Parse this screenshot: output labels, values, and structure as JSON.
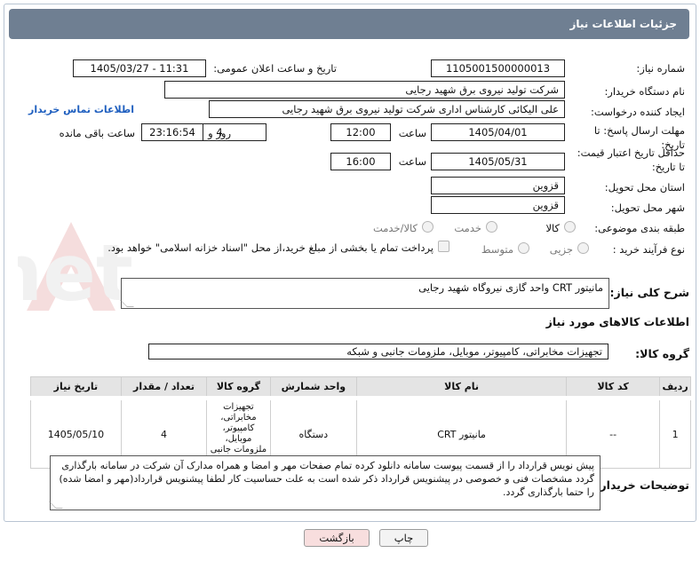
{
  "header": {
    "title": "جزئیات اطلاعات نیاز"
  },
  "fields": {
    "need_number_label": "شماره نیاز:",
    "need_number": "1105001500000013",
    "announce_label": "تاریخ و ساعت اعلان عمومی:",
    "announce_value": "1405/03/27 - 11:31",
    "buyer_org_label": "نام دستگاه خریدار:",
    "buyer_org": "شرکت تولید نیروی برق شهید رجایی",
    "creator_label": "ایجاد کننده درخواست:",
    "creator": "علی الیکائی کارشناس اداری شرکت تولید نیروی برق شهید رجایی",
    "contact_link": "اطلاعات تماس خریدار",
    "deadline_label_1": "مهلت ارسال پاسخ: تا",
    "deadline_label_2": "تاریخ:",
    "deadline_date": "1405/04/01",
    "time_label": "ساعت",
    "deadline_time": "12:00",
    "days_value": "4",
    "days_label": "روز و",
    "remaining_time": "23:16:54",
    "remaining_label": "ساعت باقی مانده",
    "price_label_1": "حداقل تاریخ اعتبار قیمت:",
    "price_label_2": "تا تاریخ:",
    "price_date": "1405/05/31",
    "price_time": "16:00",
    "province_label": "استان محل تحویل:",
    "province": "قزوین",
    "city_label": "شهر محل تحویل:",
    "city": "قزوین",
    "category_label": "طبقه بندی موضوعی:",
    "category_options": [
      "کالا",
      "خدمت",
      "کالا/خدمت"
    ],
    "process_label": "نوع فرآیند خرید :",
    "process_options": [
      "جزیی",
      "متوسط"
    ],
    "payment_note": "پرداخت تمام یا بخشی از مبلغ خرید،از محل \"اسناد خزانه اسلامی\" خواهد بود.",
    "description_label": "شرح کلی نیاز:",
    "description": "مانیتور CRT واحد گازی نیروگاه شهید رجایی",
    "goods_info_title": "اطلاعات کالاهای مورد نیاز",
    "goods_group_label": "گروه کالا:",
    "goods_group": "تجهیزات مخابراتی، کامپیوتر، موبایل، ملزومات جانبی و شبکه",
    "buyer_notes_label": "توضیحات خریدار:",
    "buyer_notes": "پیش نویس قرارداد را از قسمت پیوست سامانه دانلود کرده تمام صفحات مهر و امضا و همراه مدارک آن شرکت در سامانه بارگذاری گردد مشخصات فنی و خصوصی در پیشنویس قرارداد ذکر شده است به علت حساسیت کار لطفا  پیشنویس قرارداد(مهر و امضا شده)  را حتما بارگذاری گردد."
  },
  "table": {
    "headers": [
      "ردیف",
      "کد کالا",
      "نام کالا",
      "واحد شمارش",
      "گروه کالا",
      "تعداد / مقدار",
      "تاریخ نیاز"
    ],
    "rows": [
      [
        "1",
        "--",
        "مانیتور CRT",
        "دستگاه",
        "تجهیزات مخابراتی، کامپیوتر، موبایل، ملزومات جانبی و شبکه",
        "4",
        "1405/05/10"
      ]
    ]
  },
  "buttons": {
    "print": "چاپ",
    "back": "بازگشت"
  },
  "watermark": {
    "text": "AriaTender.net"
  },
  "colors": {
    "header_bg": "#6f7f92",
    "link": "#1f5fbf",
    "back_button_bg": "#f8dede"
  }
}
